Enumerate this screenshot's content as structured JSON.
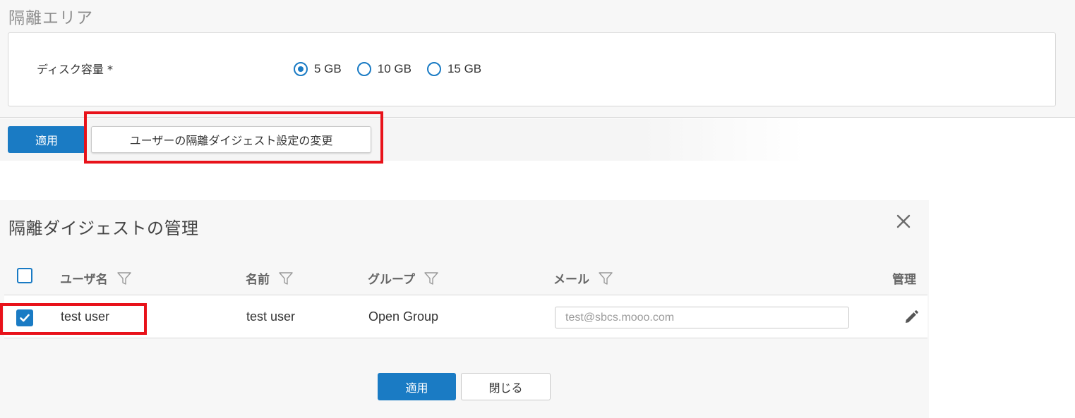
{
  "quarantine": {
    "title": "隔離エリア",
    "disk_label": "ディスク容量 *",
    "options": [
      "5 GB",
      "10 GB",
      "15 GB"
    ],
    "selected": "5 GB"
  },
  "top_actions": {
    "apply_label": "適用",
    "change_digest_label": "ユーザーの隔離ダイジェスト設定の変更"
  },
  "dialog": {
    "title": "隔離ダイジェストの管理",
    "columns": {
      "username": "ユーザ名",
      "name": "名前",
      "group": "グループ",
      "email": "メール",
      "manage": "管理"
    },
    "rows": [
      {
        "username": "test user",
        "name": "test user",
        "group": "Open Group",
        "email_placeholder": "test@sbcs.mooo.com",
        "checked": true
      }
    ],
    "apply_label": "適用",
    "close_label": "閉じる"
  },
  "colors": {
    "accent": "#1a7bc4",
    "highlight": "#e8121a"
  },
  "icons": [
    "filter-icon",
    "close-icon",
    "pencil-icon",
    "check-icon"
  ]
}
